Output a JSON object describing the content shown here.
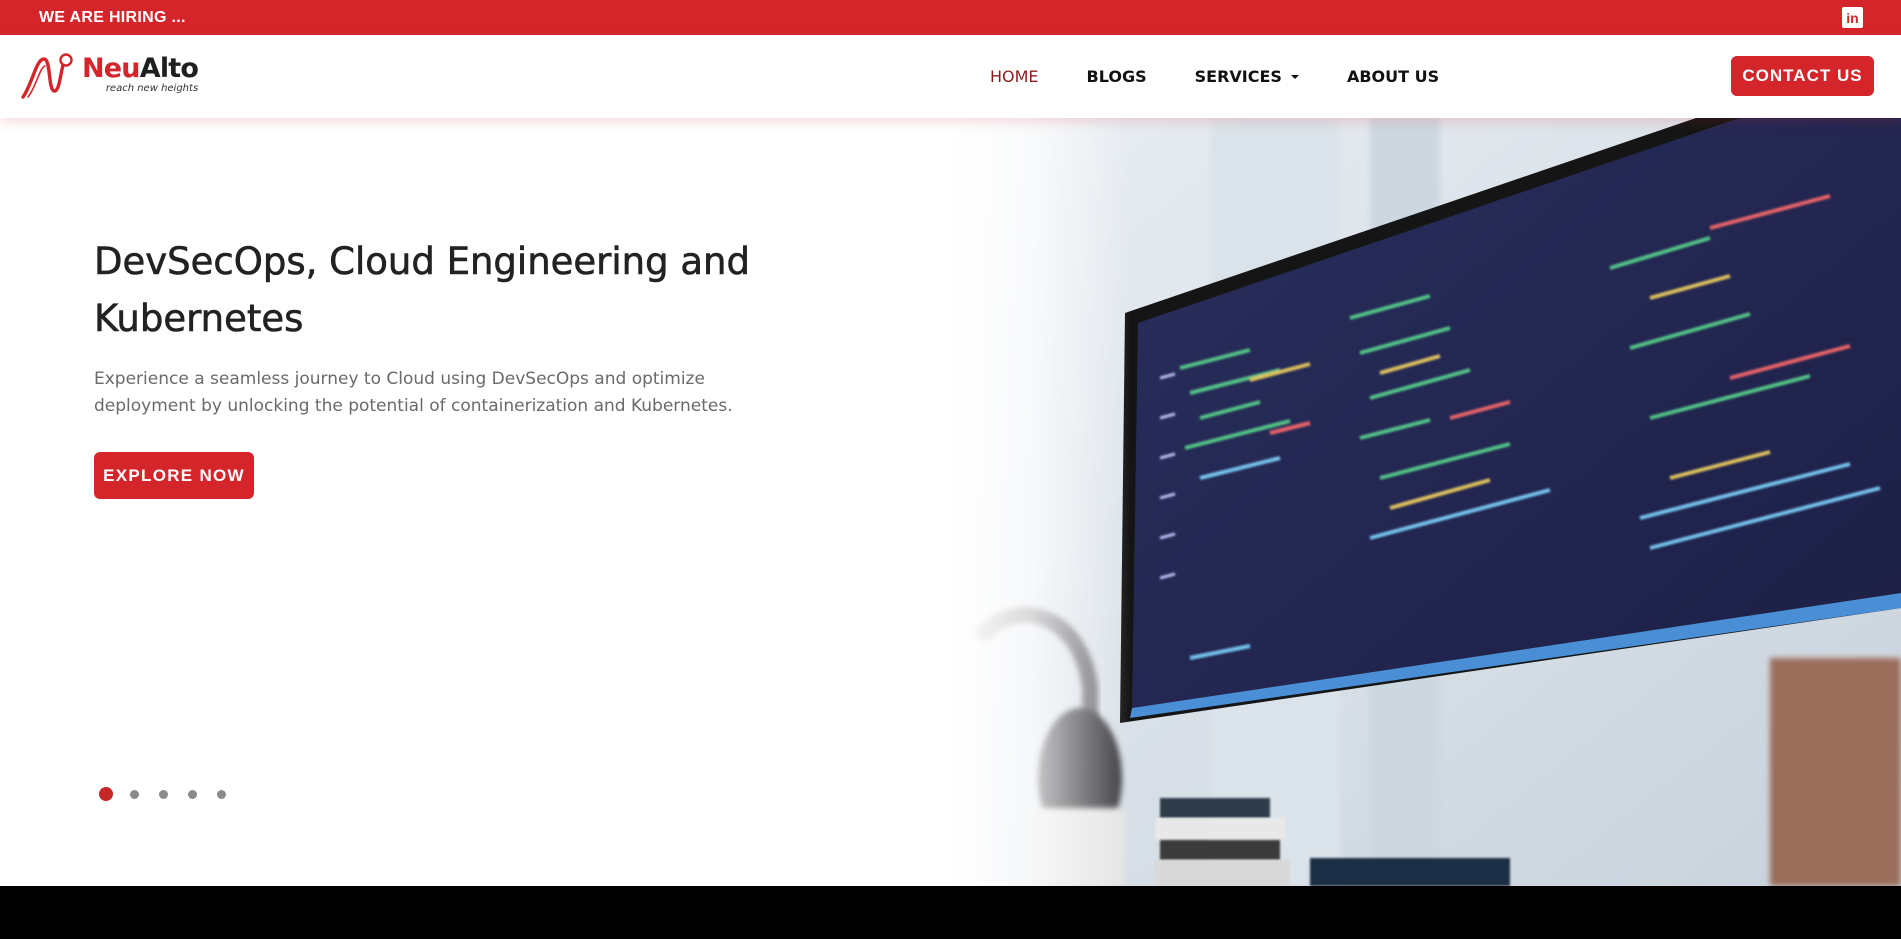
{
  "topbar": {
    "hiring_text": "WE ARE HIRING ...",
    "social_icon": "linkedin-icon",
    "social_glyph": "in"
  },
  "header": {
    "logo": {
      "name_part1": "Neu",
      "name_part2": "Alto",
      "tagline": "reach new heights"
    },
    "nav": [
      {
        "label": "HOME",
        "active": true
      },
      {
        "label": "BLOGS",
        "active": false
      },
      {
        "label": "SERVICES",
        "active": false,
        "has_dropdown": true
      },
      {
        "label": "ABOUT US",
        "active": false
      }
    ],
    "contact_label": "CONTACT US"
  },
  "hero": {
    "title": "DevSecOps, Cloud Engineering and Kubernetes",
    "description": "Experience a seamless journey to Cloud using DevSecOps and optimize deployment by unlocking the potential of containerization and Kubernetes.",
    "cta_label": "EXPLORE NOW",
    "carousel": {
      "slide_count": 5,
      "active_index": 0
    },
    "image_subject": "monitor-with-code-image"
  },
  "colors": {
    "brand_red": "#d4252a",
    "nav_active": "#8b1c1e",
    "text_dark": "#222222",
    "text_muted": "#6a6a6a"
  }
}
